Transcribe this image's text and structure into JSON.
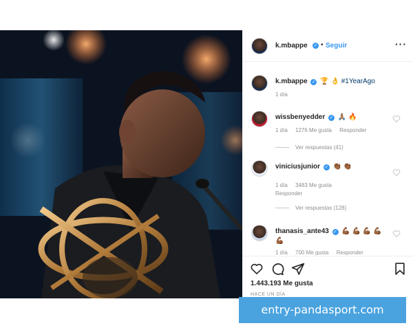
{
  "post": {
    "author": "k.mbappe",
    "follow_separator": "•",
    "follow_label": "Seguir",
    "more_label": "···"
  },
  "caption": {
    "username": "k.mbappe",
    "emojis": "🏆 👌",
    "hashtag": "#1YearAgo",
    "time": "1 día"
  },
  "comments": [
    {
      "username": "wissbenyedder",
      "emojis": "🙏🏽 🔥",
      "time": "1 día",
      "likes": "1276 Me gusta",
      "reply": "Responder",
      "view_replies": "Ver respuestas (41)"
    },
    {
      "username": "viniciusjunior",
      "emojis": "👏🏾 👏🏾",
      "time": "1 día",
      "likes": "3483 Me gusta",
      "reply": "Responder",
      "view_replies": "Ver respuestas (128)"
    },
    {
      "username": "thanasis_ante43",
      "emojis": "💪🏾 💪🏾 💪🏾 💪🏾",
      "emojis2": "💪🏾",
      "time": "1 día",
      "likes": "700 Me gusta",
      "reply": "Responder"
    }
  ],
  "actions": {
    "likes": "1.443.193 Me gusta",
    "time_ago": "HACE UN DÍA"
  },
  "watermark": "entry-pandasport.com",
  "icons": {
    "like": "heart-icon",
    "comment": "comment-icon",
    "share": "share-icon",
    "save": "bookmark-icon",
    "verified": "verified-badge-icon"
  },
  "colors": {
    "accent": "#3897f0",
    "watermark_bg": "#4aa3df",
    "secondary_text": "#8e8e8e"
  }
}
